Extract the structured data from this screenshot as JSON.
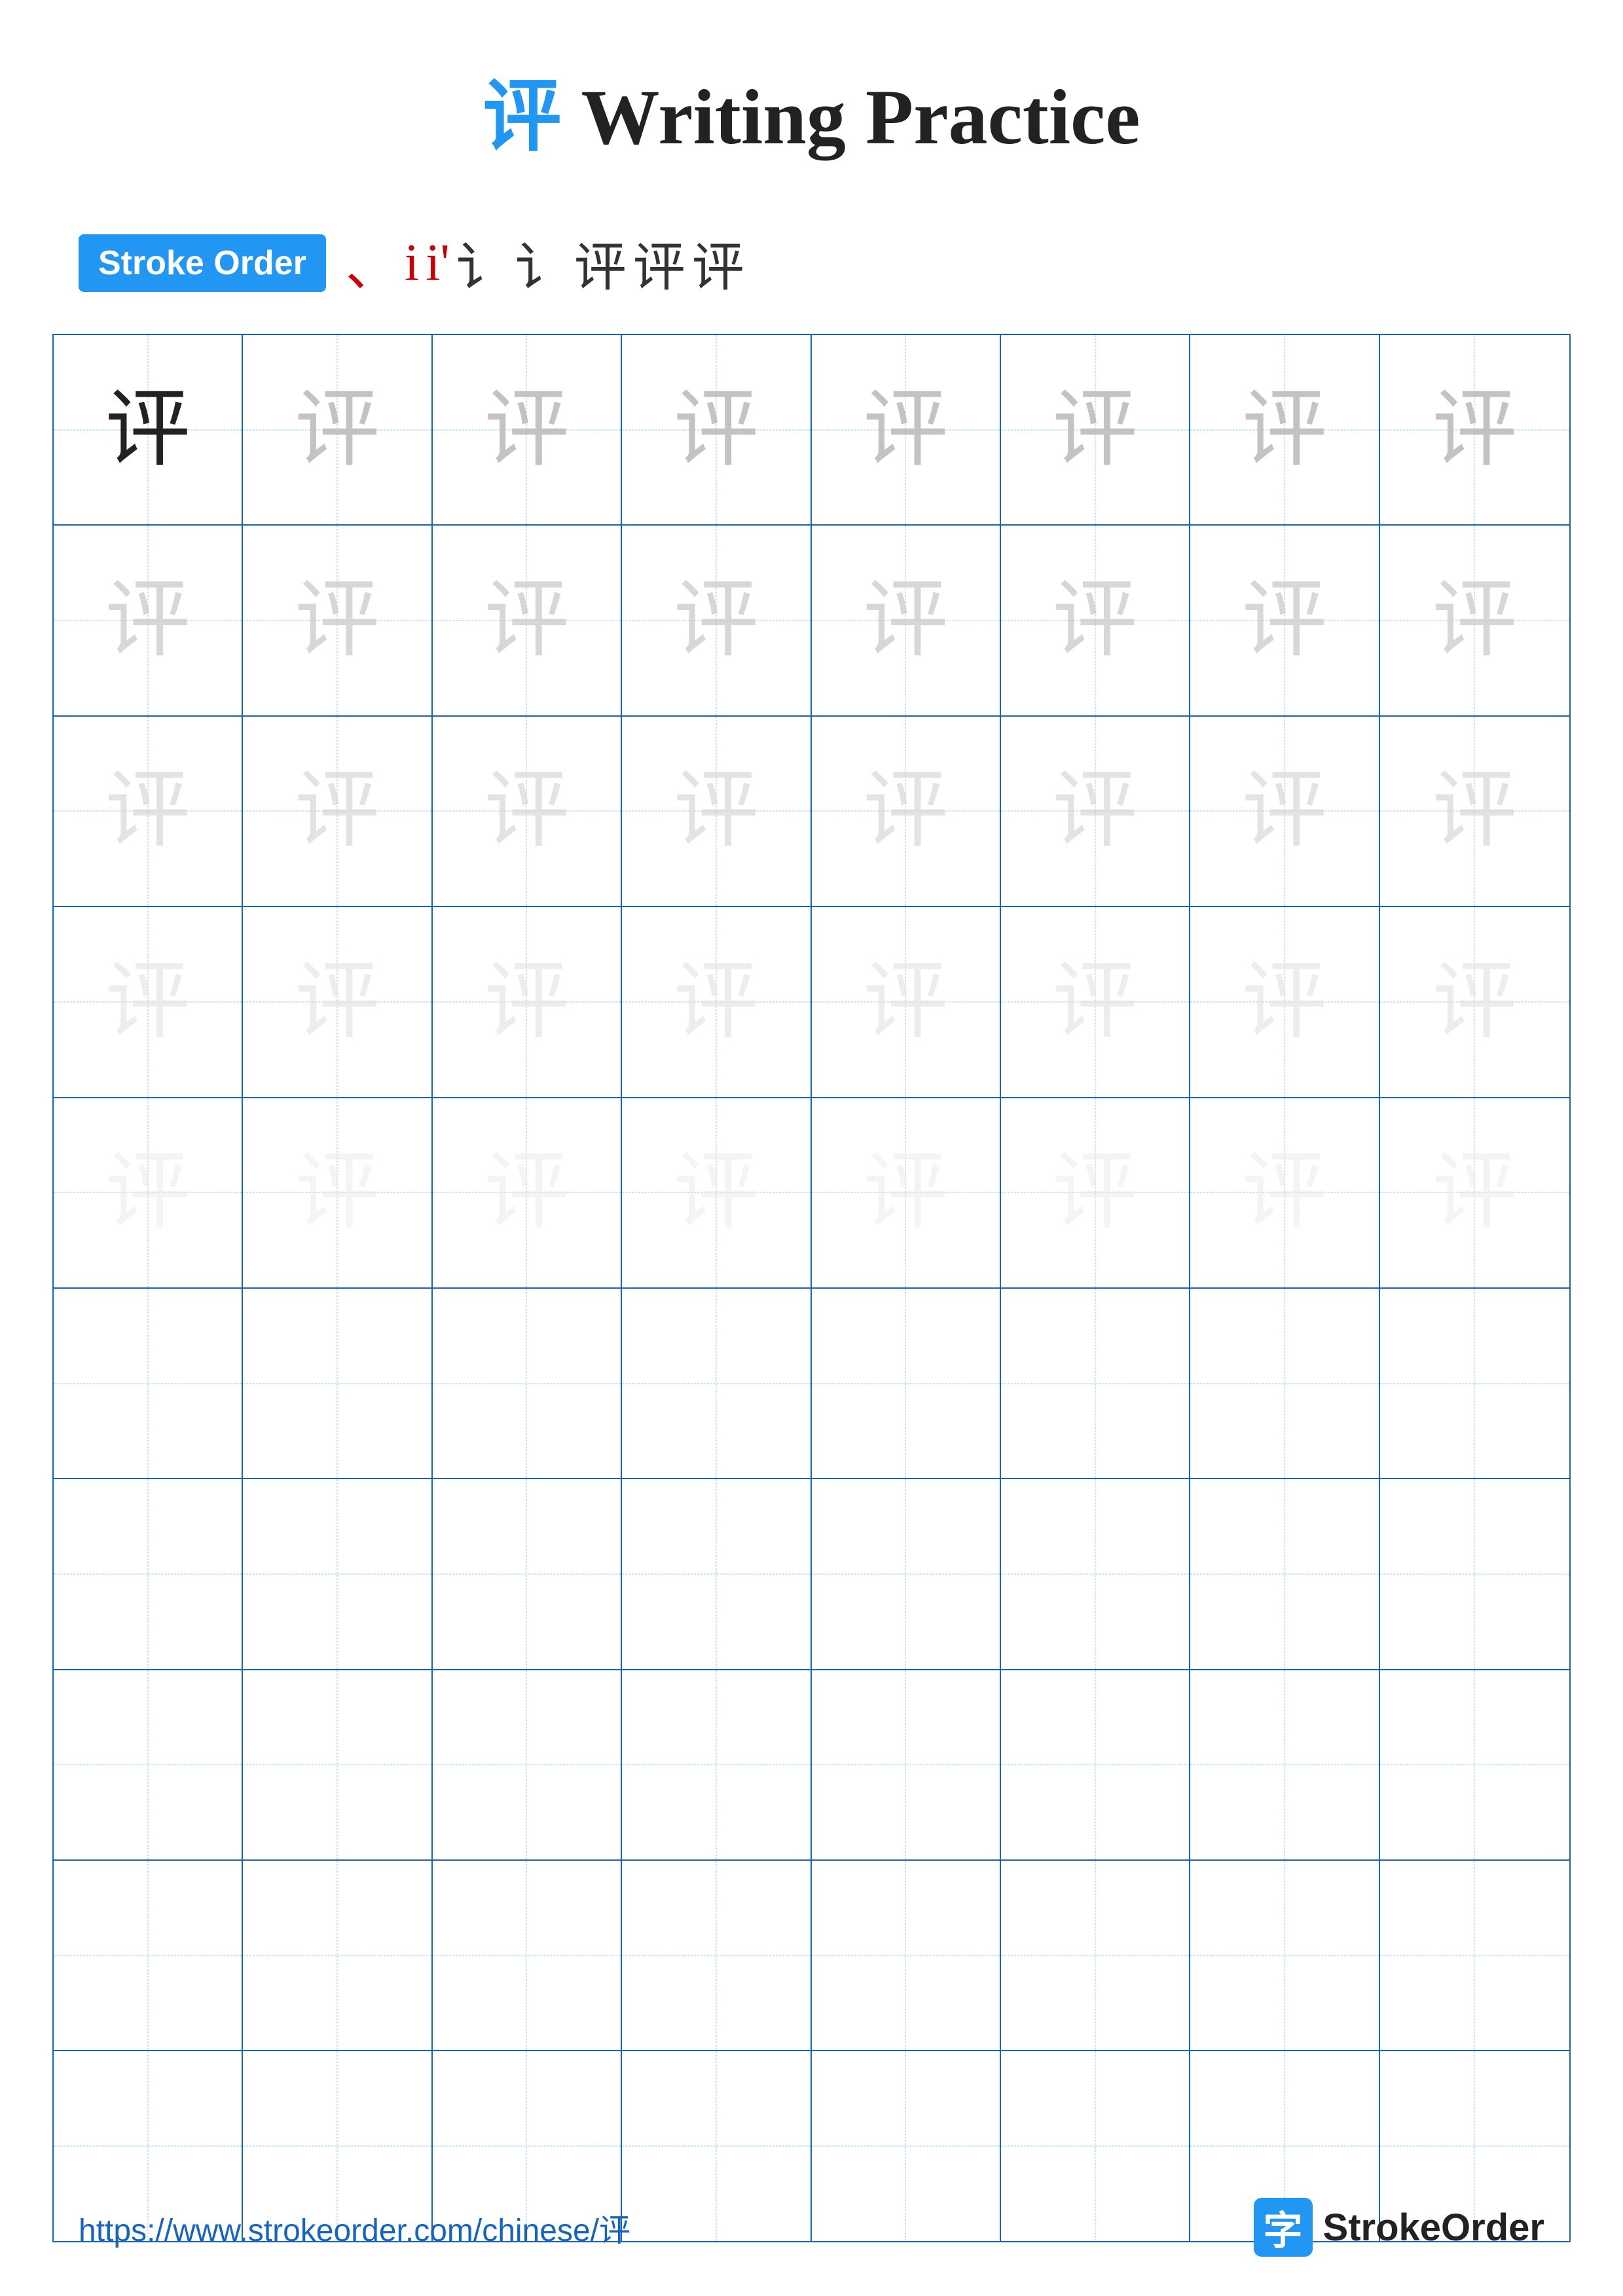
{
  "page": {
    "title_char": "评",
    "title_text": " Writing Practice"
  },
  "stroke_order": {
    "badge_label": "Stroke Order",
    "sequence": [
      "、",
      "i",
      "i'",
      "i''",
      "讠",
      "讠+",
      "评",
      "评"
    ]
  },
  "grid": {
    "rows": 10,
    "cols": 8,
    "practice_char": "评",
    "filled_rows": 5,
    "char_opacity_levels": [
      "dark",
      "light1",
      "light2",
      "light3",
      "light4",
      "light5"
    ]
  },
  "footer": {
    "url": "https://www.strokeorder.com/chinese/评",
    "brand_icon_char": "字",
    "brand_name": "StrokeOrder"
  }
}
